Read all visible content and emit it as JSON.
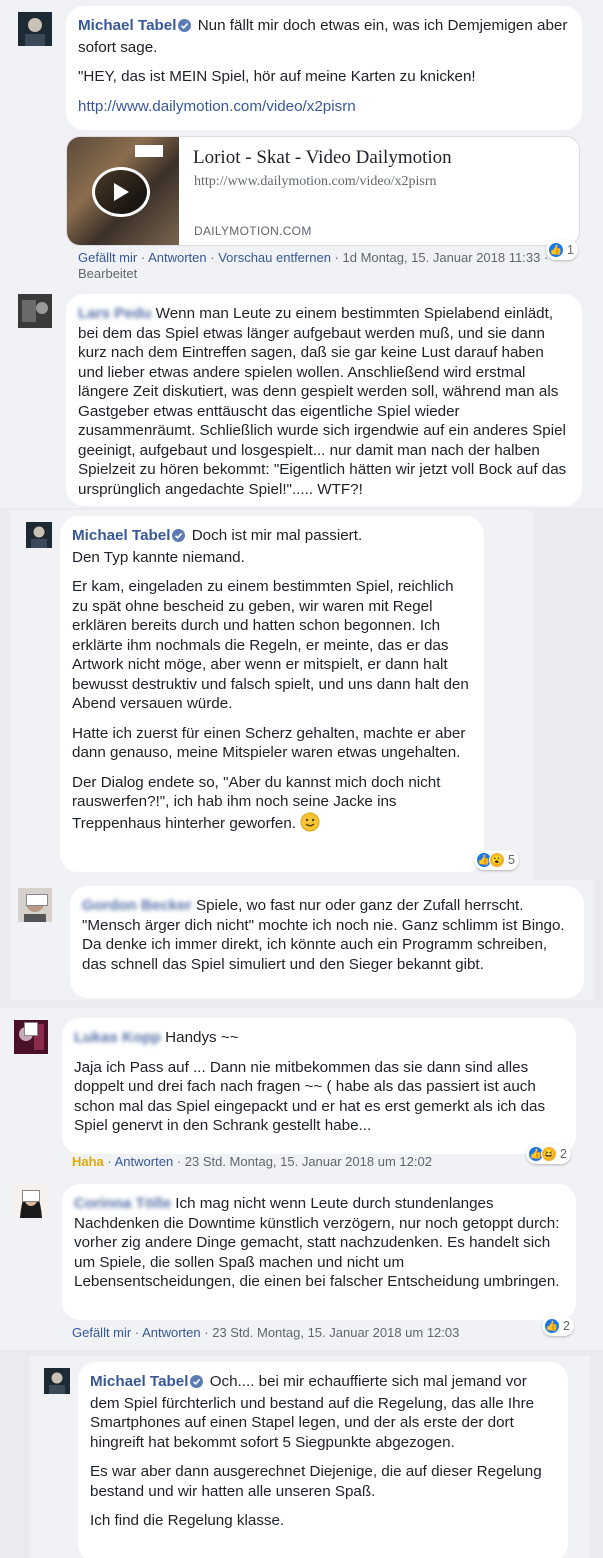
{
  "comments": [
    {
      "author": "Michael Tabel",
      "text": "Nun fällt mir doch etwas ein, was ich Demjemigen aber sofort sage.",
      "text2": "\"HEY, das ist MEIN Spiel, hör auf meine Karten zu knicken!",
      "link": "http://www.dailymotion.com/video/x2pisrn",
      "preview": {
        "title": "Loriot - Skat - Video Dailymotion",
        "url": "http://www.dailymotion.com/video/x2pisrn",
        "domain": "DAILYMOTION.COM"
      },
      "actions": [
        "Gefällt mir",
        "Antworten",
        "Vorschau entfernen"
      ],
      "time": "1d Montag, 15. Januar 2018 11:33",
      "edited": "Bearbeitet",
      "reaction_count": "1"
    },
    {
      "author": "Lars Pedu",
      "text": "Wenn man Leute zu einem bestimmten Spielabend einlädt, bei dem das Spiel etwas länger aufgebaut werden muß, und sie dann kurz nach dem Eintreffen sagen, daß sie gar keine Lust darauf haben und lieber etwas andere spielen wollen. Anschließend wird erstmal längere Zeit diskutiert, was denn gespielt werden soll, während man als Gastgeber etwas enttäuscht das eigentliche Spiel wieder zusammenräumt. Schließlich wurde sich irgendwie auf ein anderes Spiel geeinigt, aufgebaut und losgespielt... nur damit man nach der halben Spielzeit zu hören bekommt: \"Eigentlich hätten wir jetzt voll Bock auf das ursprünglich angedachte Spiel!\"..... WTF?!"
    },
    {
      "author": "Michael Tabel",
      "p1": "Doch ist mir mal passiert.",
      "p1b": "Den Typ kannte niemand.",
      "p2": "Er kam, eingeladen zu einem bestimmten Spiel, reichlich zu spät ohne bescheid zu geben, wir waren mit Regel erklären bereits durch und hatten schon begonnen. Ich erklärte ihm nochmals die Regeln, er meinte, das er das Artwork nicht möge, aber wenn er mitspielt, er dann halt bewusst destruktiv und falsch spielt, und uns dann halt den Abend versauen würde.",
      "p3": "Hatte ich zuerst für einen Scherz gehalten, machte er aber dann genauso, meine Mitspieler waren etwas ungehalten.",
      "p4": "Der Dialog endete so, \"Aber du kannst mich doch nicht rauswerfen?!\", ich hab ihm noch seine Jacke ins Treppenhaus hinterher geworfen.",
      "reaction_count": "5"
    },
    {
      "author": "Gordon Becker",
      "text": "Spiele, wo fast nur oder ganz der Zufall herrscht. \"Mensch ärger dich nicht\" mochte ich noch nie. Ganz schlimm ist Bingo. Da denke ich immer direkt, ich könnte auch ein Programm schreiben, das schnell das Spiel simuliert und den Sieger bekannt gibt."
    },
    {
      "author": "Lukas Kopp",
      "head": "Handys ~~",
      "text": "Jaja ich Pass auf ... Dann nie mitbekommen das sie dann sind alles doppelt und drei fach nach fragen ~~ ( habe als das passiert ist auch schon mal das Spiel eingepackt und er hat es erst gemerkt als ich das Spiel genervt in den Schrank gestellt habe...",
      "actions": [
        "Haha",
        "Antworten"
      ],
      "time": "23 Std. Montag, 15. Januar 2018 um 12:02",
      "reaction_count": "2"
    },
    {
      "author": "Corinna Tölle",
      "text": "Ich mag nicht wenn Leute durch stundenlanges Nachdenken die Downtime künstlich verzögern, nur noch getoppt durch: vorher zig andere Dinge gemacht, statt nachzudenken. Es handelt sich um Spiele, die sollen Spaß machen und nicht um Lebensentscheidungen, die einen bei falscher Entscheidung umbringen.",
      "actions": [
        "Gefällt mir",
        "Antworten"
      ],
      "time": "23 Std. Montag, 15. Januar 2018 um 12:03",
      "reaction_count": "2"
    },
    {
      "author": "Michael Tabel",
      "p1": "Och.... bei mir echauffierte sich mal jemand vor dem Spiel fürchterlich und bestand auf die Regelung, das alle Ihre Smartphones auf einen Stapel legen, und der als erste der dort hingreift hat bekommt sofort 5 Siegpunkte abgezogen.",
      "p2": "Es war aber dann ausgerechnet Diejenige, die auf dieser Regelung bestand und wir hatten alle unseren Spaß.",
      "p3": "Ich find die Regelung klasse."
    }
  ],
  "colors": {
    "link": "#385898",
    "background": "#f0f2f5",
    "bubble": "#ffffff",
    "meta": "#606770"
  }
}
